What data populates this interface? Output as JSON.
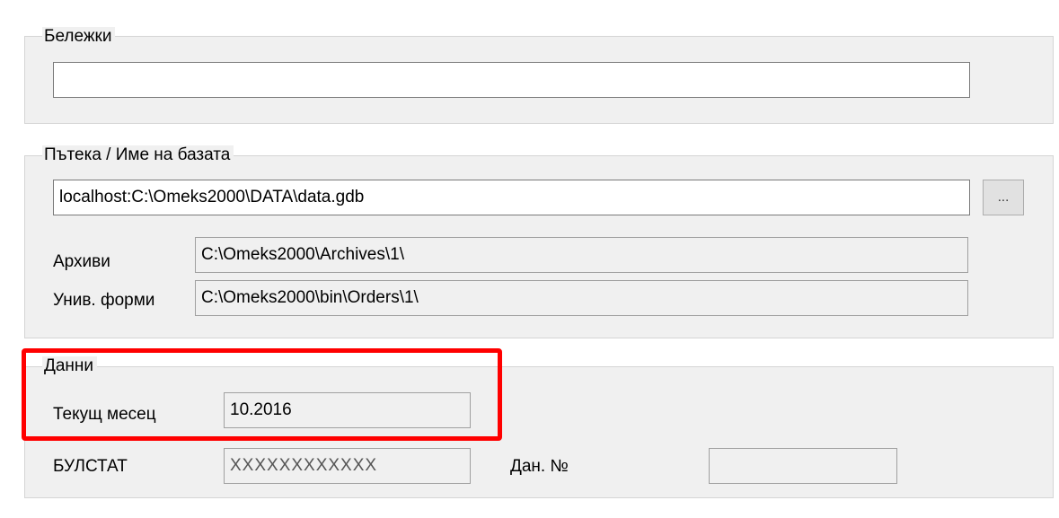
{
  "notes": {
    "title": "Бележки",
    "value": ""
  },
  "db_path": {
    "title": "Пътека / Име на базата",
    "path_value": "localhost:C:\\Omeks2000\\DATA\\data.gdb",
    "browse_label": "...",
    "archives_label": "Архиви",
    "archives_value": "C:\\Omeks2000\\Archives\\1\\",
    "univ_forms_label": "Унив. форми",
    "univ_forms_value": "C:\\Omeks2000\\bin\\Orders\\1\\"
  },
  "data_group": {
    "title": "Данни",
    "current_month_label": "Текущ месец",
    "current_month_value": "10.2016",
    "bulstat_label": "БУЛСТАТ",
    "bulstat_value": "XXXXXXXXXXXX",
    "tax_no_label": "Дан. №",
    "tax_no_value": ""
  },
  "annotation": {
    "highlight_color": "#ff0000"
  }
}
